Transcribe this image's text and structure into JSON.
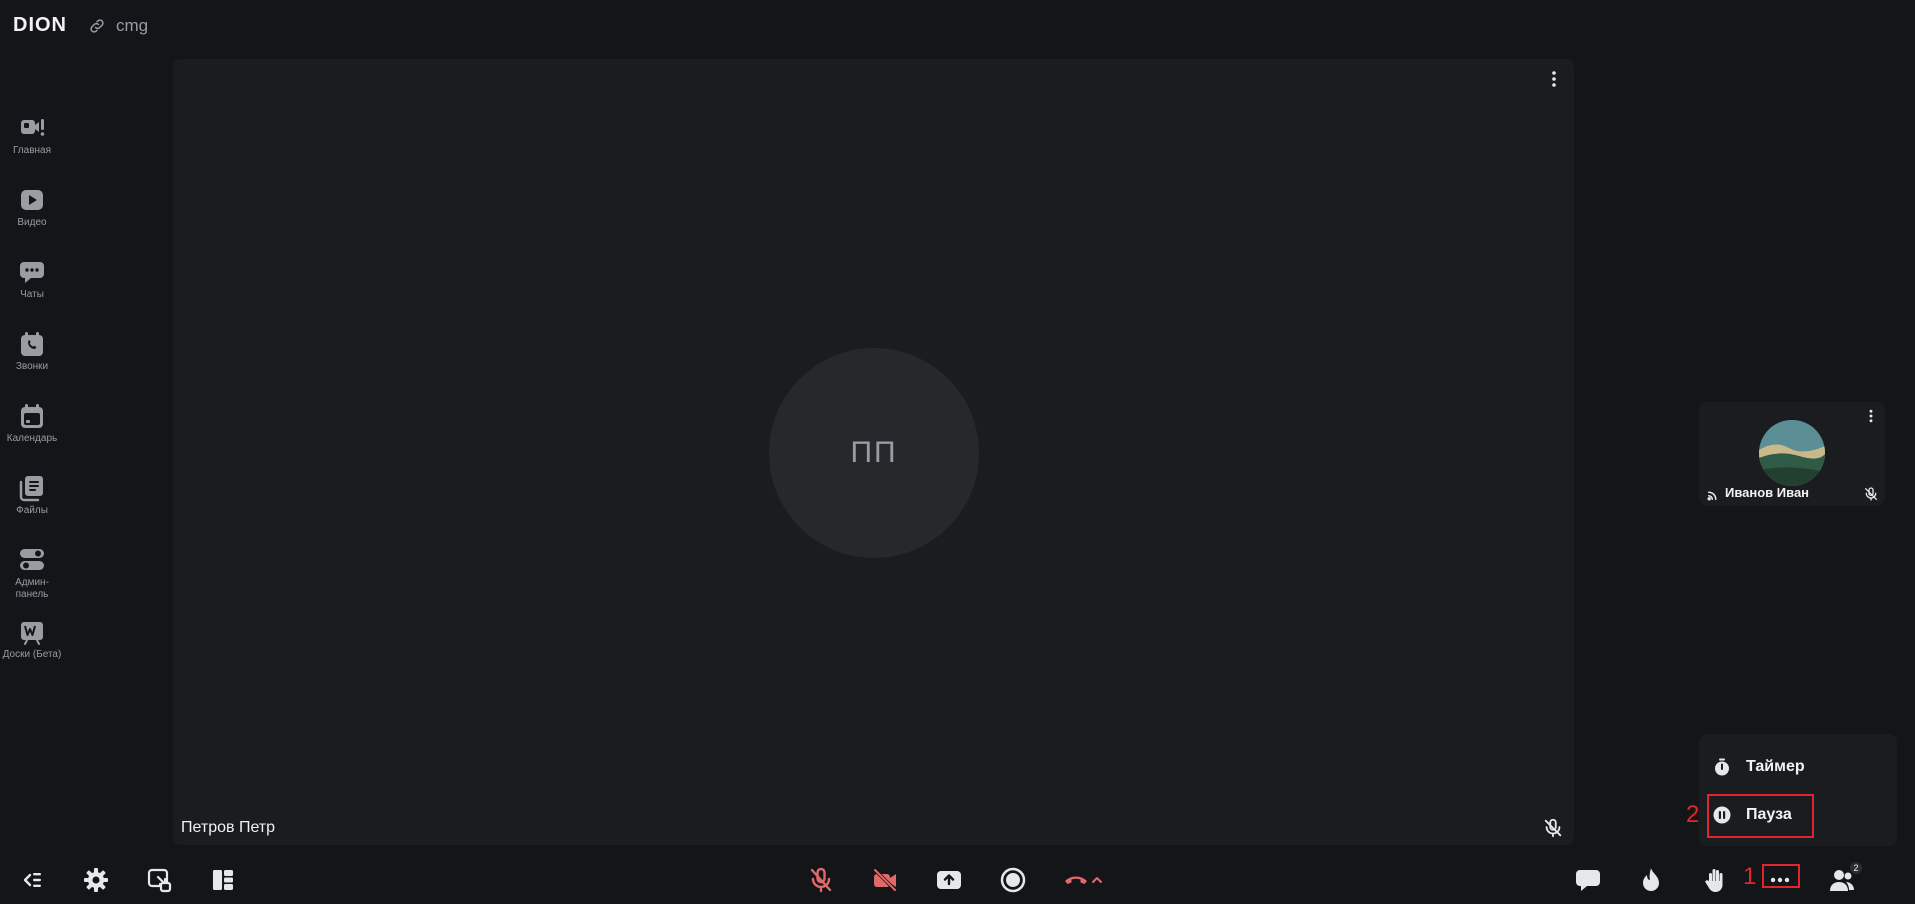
{
  "app": {
    "logo": "DION",
    "room_name": "cmg"
  },
  "sidebar": {
    "items": [
      {
        "label": "Главная",
        "icon": "home-camera-icon"
      },
      {
        "label": "Видео",
        "icon": "video-play-icon"
      },
      {
        "label": "Чаты",
        "icon": "chat-icon"
      },
      {
        "label": "Звонки",
        "icon": "phone-calendar-icon"
      },
      {
        "label": "Календарь",
        "icon": "calendar-icon"
      },
      {
        "label": "Файлы",
        "icon": "files-icon"
      },
      {
        "label": "Админ-",
        "label2": "панель",
        "icon": "admin-toggle-icon"
      },
      {
        "label": "Доски (Бета)",
        "icon": "board-icon"
      }
    ]
  },
  "stage": {
    "initials": "ПП",
    "participant_name": "Петров Петр"
  },
  "tile": {
    "participant_name": "Иванов Иван"
  },
  "popup": {
    "items": [
      {
        "label": "Таймер",
        "icon": "timer-icon"
      },
      {
        "label": "Пауза",
        "icon": "pause-icon"
      }
    ]
  },
  "toolbar": {
    "participants_count": "2"
  },
  "annotations": {
    "one": "1",
    "two": "2"
  },
  "colors": {
    "background": "#141518",
    "panel": "#1b1c1f",
    "avatar": "#27282c",
    "muted_red": "#e06a6a",
    "annotation": "#e0262b"
  }
}
